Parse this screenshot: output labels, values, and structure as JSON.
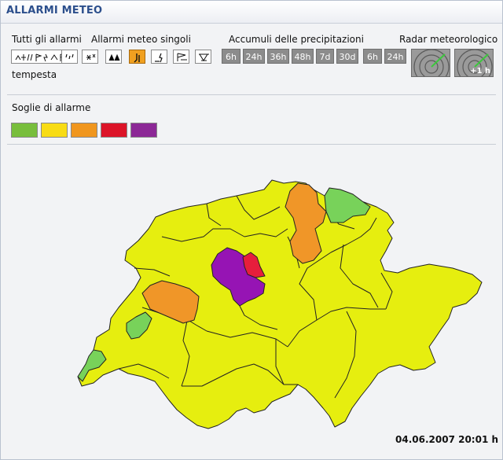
{
  "header": {
    "title": "ALLARMI METEO"
  },
  "sections": {
    "all_alarms": "Tutti gli allarmi",
    "single_alarms": "Allarmi meteo singoli",
    "precip": "Accumuli delle precipitazioni",
    "radar": "Radar meteorologico"
  },
  "tooltip_label": "tempesta",
  "alarm_buttons": [
    {
      "icon": "all-hazards-icon",
      "active": false
    },
    {
      "icon": "rain-icon",
      "active": false
    },
    {
      "icon": "snow-icon",
      "active": false
    },
    {
      "icon": "thunderstorm-icon",
      "active": false
    },
    {
      "icon": "wind-icon",
      "active": true
    },
    {
      "icon": "slippery-road-icon",
      "active": false
    },
    {
      "icon": "flood-icon",
      "active": false
    },
    {
      "icon": "frost-icon",
      "active": false
    }
  ],
  "precip_buttons": [
    "6h",
    "24h",
    "36h",
    "48h",
    "7d",
    "30d",
    "6h",
    "24h"
  ],
  "radar_buttons": [
    {
      "label": ""
    },
    {
      "label": "+1 h"
    }
  ],
  "thresholds": {
    "title": "Soglie di allarme",
    "levels": [
      {
        "level": 1,
        "color": "#78be3c"
      },
      {
        "level": 2,
        "color": "#f8dc14"
      },
      {
        "level": 3,
        "color": "#f0961e"
      },
      {
        "level": 4,
        "color": "#dc1428"
      },
      {
        "level": 5,
        "color": "#8c2896"
      }
    ]
  },
  "map": {
    "region_colors": {
      "yellow": "#e6ee0f",
      "green": "#78d25a",
      "orange": "#f09628",
      "red": "#e61e3c",
      "purple": "#9614b4",
      "outline": "#222222"
    }
  },
  "timestamp": "04.06.2007 20:01 h"
}
